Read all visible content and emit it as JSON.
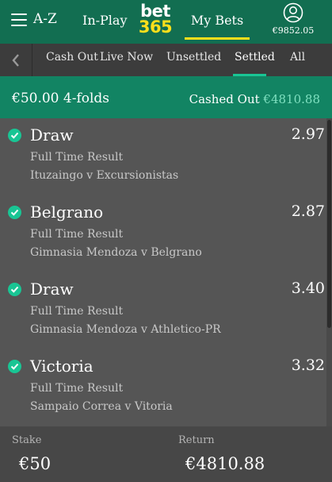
{
  "header": {
    "menu_label": "A-Z",
    "menu_icon": "hamburger-icon",
    "inplay_label": "In-Play",
    "logo_top": "bet",
    "logo_bottom": "365",
    "mybets_label": "My Bets",
    "account_icon": "user-icon",
    "balance": "€9852.05",
    "brand_color": "#126e51",
    "logo_accent": "#ffdf1b"
  },
  "subnav": {
    "back_icon": "chevron-left-icon",
    "tabs": [
      {
        "label": "Cash Out",
        "active": false
      },
      {
        "label": "Live Now",
        "active": false
      },
      {
        "label": "Unsettled",
        "active": false
      },
      {
        "label": "Settled",
        "active": true
      },
      {
        "label": "All",
        "active": false
      }
    ],
    "active_color": "#19c594"
  },
  "bet": {
    "title": "€50.00 4-folds",
    "status_label": "Cashed Out",
    "status_amount": "€4810.88",
    "selections": [
      {
        "name": "Draw",
        "odds": "2.97",
        "market": "Full Time Result",
        "event": "Ituzaingo v Excursionistas",
        "won": true
      },
      {
        "name": "Belgrano",
        "odds": "2.87",
        "market": "Full Time Result",
        "event": "Gimnasia Mendoza v Belgrano",
        "won": true
      },
      {
        "name": "Draw",
        "odds": "3.40",
        "market": "Full Time Result",
        "event": "Gimnasia Mendoza v Athletico-PR",
        "won": true
      },
      {
        "name": "Victoria",
        "odds": "3.32",
        "market": "Full Time Result",
        "event": "Sampaio Correa v Vitoria",
        "won": true
      }
    ],
    "stake_label": "Stake",
    "stake_value": "€50",
    "return_label": "Return",
    "return_value": "€4810.88"
  }
}
